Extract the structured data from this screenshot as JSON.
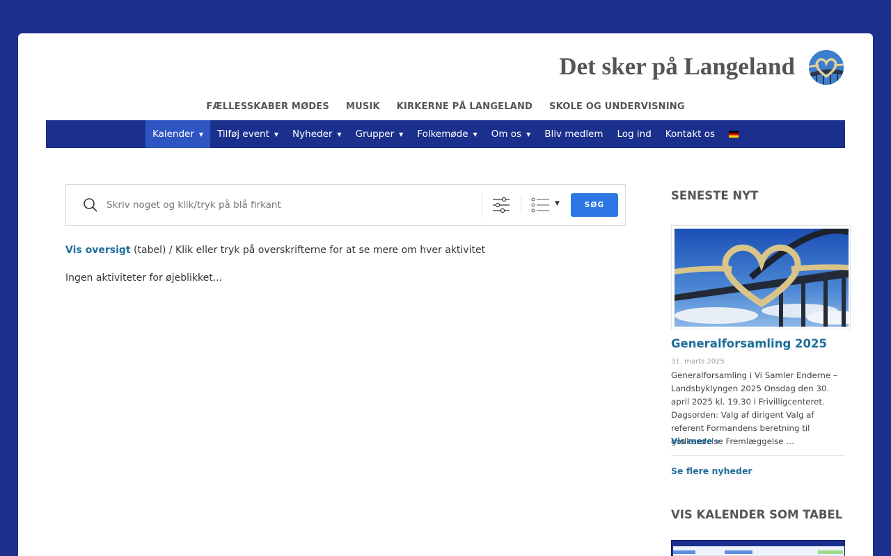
{
  "header": {
    "site_title": "Det sker på Langeland"
  },
  "top_menu": [
    {
      "label": "FÆLLESSKABER MØDES"
    },
    {
      "label": "MUSIK"
    },
    {
      "label": "KIRKERNE PÅ LANGELAND"
    },
    {
      "label": "SKOLE OG UNDERVISNING"
    }
  ],
  "main_nav": [
    {
      "label": "Kalender",
      "has_dropdown": true,
      "active": true
    },
    {
      "label": "Tilføj event",
      "has_dropdown": true
    },
    {
      "label": "Nyheder",
      "has_dropdown": true
    },
    {
      "label": "Grupper",
      "has_dropdown": true
    },
    {
      "label": "Folkemøde",
      "has_dropdown": true
    },
    {
      "label": "Om os",
      "has_dropdown": true
    },
    {
      "label": "Bliv medlem"
    },
    {
      "label": "Log ind"
    },
    {
      "label": "Kontakt os"
    },
    {
      "label": "",
      "icon": "german-flag-icon"
    }
  ],
  "search": {
    "placeholder": "Skriv noget og klik/tryk på blå firkant",
    "value": "",
    "button_label": "SØG"
  },
  "content": {
    "overview_link": "Vis oversigt",
    "overview_rest": " (tabel) / Klik eller tryk på overskrifterne for at se mere om hver aktivitet",
    "no_activities": "Ingen aktiviteter for øjeblikket..."
  },
  "sidebar": {
    "latest_heading": "SENESTE NYT",
    "news_title": "Generalforsamling 2025",
    "news_date": "31. marts 2025",
    "news_excerpt": "  Generalforsamling i Vi Samler Enderne – Landsbyklyngen 2025 Onsdag den 30. april 2025 kl. 19.30 i Frivilligcenteret. Dagsorden: Valg af dirigent Valg af referent Formandens beretning til godkendelse Fremlæggelse …",
    "read_more": "Vis mere »",
    "more_news": "Se flere nyheder",
    "calendar_heading": "VIS KALENDER SOM TABEL"
  },
  "colors": {
    "background": "#1b2f8d",
    "nav_active": "#2e55c2",
    "button": "#2d77e5",
    "link": "#1f6e9a"
  }
}
